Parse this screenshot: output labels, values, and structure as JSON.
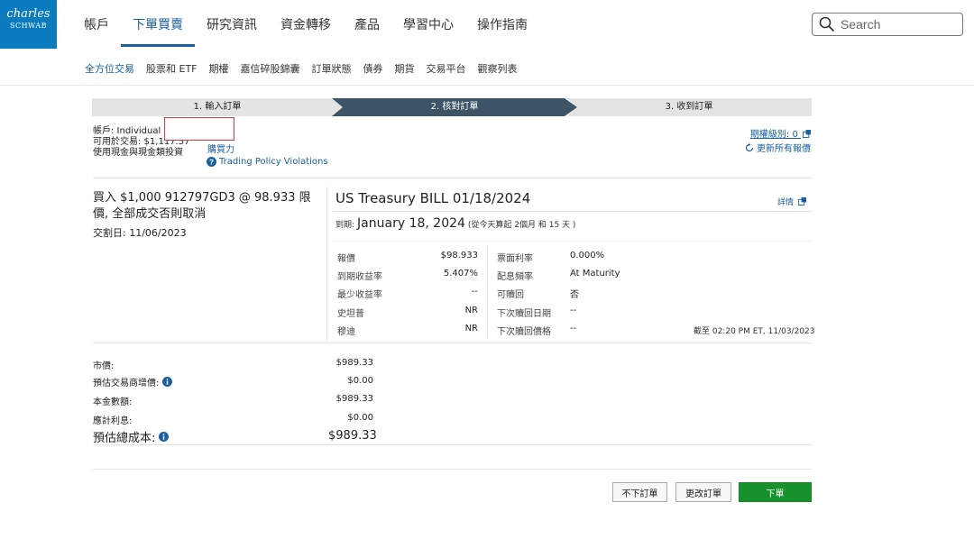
{
  "logo": {
    "line1": "charles",
    "line2": "SCHWAB"
  },
  "nav": {
    "items": [
      "帳戶",
      "下單買賣",
      "研究資訊",
      "資金轉移",
      "產品",
      "學習中心",
      "操作指南"
    ],
    "active_index": 1
  },
  "search": {
    "placeholder": "Search"
  },
  "subnav": {
    "items": [
      "全方位交易",
      "股票和 ETF",
      "期權",
      "嘉信碎股錦囊",
      "訂單狀態",
      "債券",
      "期貨",
      "交易平台",
      "觀察列表"
    ],
    "active_index": 0
  },
  "steps": [
    "1. 輸入訂單",
    "2. 核對訂單",
    "3. 收到訂單"
  ],
  "account": {
    "label_line": "帳戶: Individual 2",
    "available": "可用於交易: $1,117.57",
    "cash_type": "使用現金與現金類投資",
    "buying_power_link": "購買力",
    "policy_link": "Trading Policy Violations",
    "option_level": "期權級別: 0",
    "refresh": "更新所有報價"
  },
  "order": {
    "summary": "買入 $1,000 912797GD3 @ 98.933  限價, 全部成交否則取消",
    "trade_date": "交割日: 11/06/2023"
  },
  "security": {
    "title": "US Treasury BILL 01/18/2024",
    "details_link": "詳情",
    "maturity_label": "到期:",
    "maturity_date": "January 18, 2024",
    "maturity_note": "(從今天算起 2個月 和 15 天 )",
    "left_rows": [
      {
        "label": "報價",
        "value": "$98.933"
      },
      {
        "label": "到期收益率",
        "value": "5.407%"
      },
      {
        "label": "最少收益率",
        "value": "--"
      },
      {
        "label": "史坦普",
        "value": "NR"
      },
      {
        "label": "穆迪",
        "value": "NR"
      }
    ],
    "right_rows": [
      {
        "label": "票面利率",
        "value": "0.000%"
      },
      {
        "label": "配息頻率",
        "value": "At Maturity"
      },
      {
        "label": "可贖回",
        "value": "否"
      },
      {
        "label": "下次贖回日期",
        "value": "--"
      },
      {
        "label": "下次贖回價格",
        "value": "--"
      }
    ],
    "as_of": "截至 02:20 PM ET, 11/03/2023"
  },
  "costs": [
    {
      "label": "市價:",
      "value": "$989.33"
    },
    {
      "label": "預估交易商增價:",
      "value": "$0.00"
    },
    {
      "label": "本金數額:",
      "value": "$989.33"
    },
    {
      "label": "應計利息:",
      "value": "$0.00"
    }
  ],
  "total": {
    "label": "預估總成本:",
    "value": "$989.33"
  },
  "buttons": {
    "cancel": "不下訂單",
    "change": "更改訂單",
    "place": "下單"
  },
  "colors": {
    "brand": "#0a7bbf",
    "link": "#1a5fa0",
    "active_step": "#3d5366",
    "place_order": "#17912b"
  }
}
